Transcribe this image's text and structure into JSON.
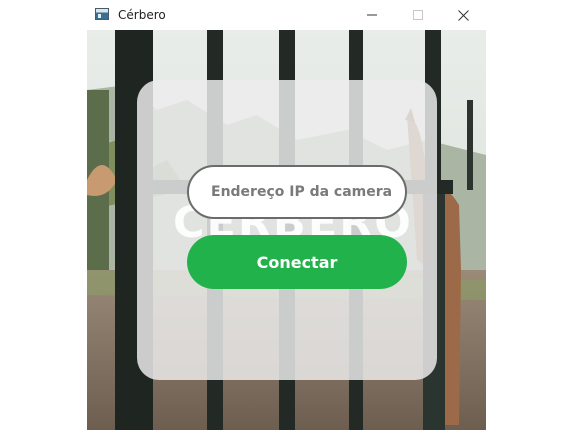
{
  "window": {
    "title": "Cérbero",
    "icon": "app-window-icon",
    "controls": [
      "minimize-icon",
      "maximize-icon",
      "close-icon"
    ]
  },
  "background": {
    "description_icon": "gate-photo"
  },
  "watermark": {
    "text": "CÉRBERO"
  },
  "form": {
    "ip_placeholder": "Endereço IP da camera",
    "ip_value": "",
    "connect_label": "Conectar"
  },
  "colors": {
    "accent": "#22b24c",
    "panel": "#ececec",
    "input_border": "#6b6b6b"
  }
}
